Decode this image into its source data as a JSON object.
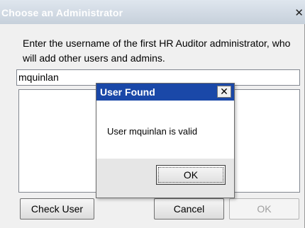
{
  "window": {
    "title": "Choose an Administrator",
    "close_glyph": "✕",
    "prompt": "Enter the username of the first HR Auditor administrator, who will add other users and admins.",
    "username_value": "mquinlan",
    "buttons": {
      "check_user": "Check User",
      "cancel": "Cancel",
      "ok": "OK"
    }
  },
  "dialog": {
    "title": "User Found",
    "close_glyph": "✕",
    "message": "User mquinlan is valid",
    "ok_label": "OK"
  }
}
